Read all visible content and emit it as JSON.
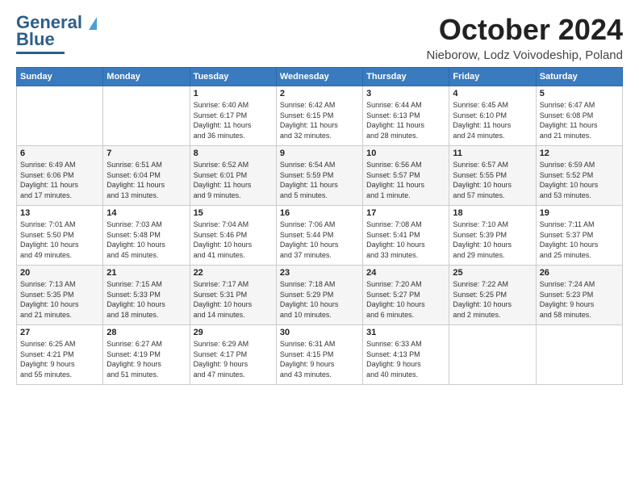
{
  "header": {
    "logo_line1": "General",
    "logo_line2": "Blue",
    "month_title": "October 2024",
    "location": "Nieborow, Lodz Voivodeship, Poland"
  },
  "days_of_week": [
    "Sunday",
    "Monday",
    "Tuesday",
    "Wednesday",
    "Thursday",
    "Friday",
    "Saturday"
  ],
  "weeks": [
    [
      {
        "day": "",
        "info": ""
      },
      {
        "day": "",
        "info": ""
      },
      {
        "day": "1",
        "info": "Sunrise: 6:40 AM\nSunset: 6:17 PM\nDaylight: 11 hours\nand 36 minutes."
      },
      {
        "day": "2",
        "info": "Sunrise: 6:42 AM\nSunset: 6:15 PM\nDaylight: 11 hours\nand 32 minutes."
      },
      {
        "day": "3",
        "info": "Sunrise: 6:44 AM\nSunset: 6:13 PM\nDaylight: 11 hours\nand 28 minutes."
      },
      {
        "day": "4",
        "info": "Sunrise: 6:45 AM\nSunset: 6:10 PM\nDaylight: 11 hours\nand 24 minutes."
      },
      {
        "day": "5",
        "info": "Sunrise: 6:47 AM\nSunset: 6:08 PM\nDaylight: 11 hours\nand 21 minutes."
      }
    ],
    [
      {
        "day": "6",
        "info": "Sunrise: 6:49 AM\nSunset: 6:06 PM\nDaylight: 11 hours\nand 17 minutes."
      },
      {
        "day": "7",
        "info": "Sunrise: 6:51 AM\nSunset: 6:04 PM\nDaylight: 11 hours\nand 13 minutes."
      },
      {
        "day": "8",
        "info": "Sunrise: 6:52 AM\nSunset: 6:01 PM\nDaylight: 11 hours\nand 9 minutes."
      },
      {
        "day": "9",
        "info": "Sunrise: 6:54 AM\nSunset: 5:59 PM\nDaylight: 11 hours\nand 5 minutes."
      },
      {
        "day": "10",
        "info": "Sunrise: 6:56 AM\nSunset: 5:57 PM\nDaylight: 11 hours\nand 1 minute."
      },
      {
        "day": "11",
        "info": "Sunrise: 6:57 AM\nSunset: 5:55 PM\nDaylight: 10 hours\nand 57 minutes."
      },
      {
        "day": "12",
        "info": "Sunrise: 6:59 AM\nSunset: 5:52 PM\nDaylight: 10 hours\nand 53 minutes."
      }
    ],
    [
      {
        "day": "13",
        "info": "Sunrise: 7:01 AM\nSunset: 5:50 PM\nDaylight: 10 hours\nand 49 minutes."
      },
      {
        "day": "14",
        "info": "Sunrise: 7:03 AM\nSunset: 5:48 PM\nDaylight: 10 hours\nand 45 minutes."
      },
      {
        "day": "15",
        "info": "Sunrise: 7:04 AM\nSunset: 5:46 PM\nDaylight: 10 hours\nand 41 minutes."
      },
      {
        "day": "16",
        "info": "Sunrise: 7:06 AM\nSunset: 5:44 PM\nDaylight: 10 hours\nand 37 minutes."
      },
      {
        "day": "17",
        "info": "Sunrise: 7:08 AM\nSunset: 5:41 PM\nDaylight: 10 hours\nand 33 minutes."
      },
      {
        "day": "18",
        "info": "Sunrise: 7:10 AM\nSunset: 5:39 PM\nDaylight: 10 hours\nand 29 minutes."
      },
      {
        "day": "19",
        "info": "Sunrise: 7:11 AM\nSunset: 5:37 PM\nDaylight: 10 hours\nand 25 minutes."
      }
    ],
    [
      {
        "day": "20",
        "info": "Sunrise: 7:13 AM\nSunset: 5:35 PM\nDaylight: 10 hours\nand 21 minutes."
      },
      {
        "day": "21",
        "info": "Sunrise: 7:15 AM\nSunset: 5:33 PM\nDaylight: 10 hours\nand 18 minutes."
      },
      {
        "day": "22",
        "info": "Sunrise: 7:17 AM\nSunset: 5:31 PM\nDaylight: 10 hours\nand 14 minutes."
      },
      {
        "day": "23",
        "info": "Sunrise: 7:18 AM\nSunset: 5:29 PM\nDaylight: 10 hours\nand 10 minutes."
      },
      {
        "day": "24",
        "info": "Sunrise: 7:20 AM\nSunset: 5:27 PM\nDaylight: 10 hours\nand 6 minutes."
      },
      {
        "day": "25",
        "info": "Sunrise: 7:22 AM\nSunset: 5:25 PM\nDaylight: 10 hours\nand 2 minutes."
      },
      {
        "day": "26",
        "info": "Sunrise: 7:24 AM\nSunset: 5:23 PM\nDaylight: 9 hours\nand 58 minutes."
      }
    ],
    [
      {
        "day": "27",
        "info": "Sunrise: 6:25 AM\nSunset: 4:21 PM\nDaylight: 9 hours\nand 55 minutes."
      },
      {
        "day": "28",
        "info": "Sunrise: 6:27 AM\nSunset: 4:19 PM\nDaylight: 9 hours\nand 51 minutes."
      },
      {
        "day": "29",
        "info": "Sunrise: 6:29 AM\nSunset: 4:17 PM\nDaylight: 9 hours\nand 47 minutes."
      },
      {
        "day": "30",
        "info": "Sunrise: 6:31 AM\nSunset: 4:15 PM\nDaylight: 9 hours\nand 43 minutes."
      },
      {
        "day": "31",
        "info": "Sunrise: 6:33 AM\nSunset: 4:13 PM\nDaylight: 9 hours\nand 40 minutes."
      },
      {
        "day": "",
        "info": ""
      },
      {
        "day": "",
        "info": ""
      }
    ]
  ]
}
